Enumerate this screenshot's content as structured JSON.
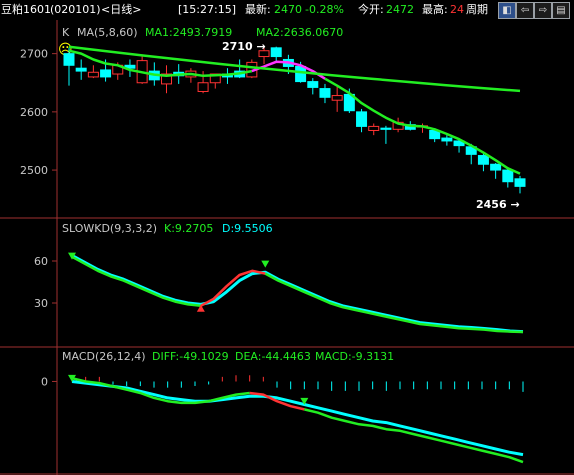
{
  "header": {
    "instrument": "豆粕1601",
    "code": "(020101)",
    "period": "<日线>",
    "time": "[15:27:15]",
    "latest_label": "最新:",
    "latest_value": "2470",
    "change_pct": "-0.28%",
    "open_label": "今开:",
    "open_value": "2472",
    "high_label": "最高:",
    "high_value": "24",
    "cycle_label": "周期",
    "nav_buttons": [
      "◧",
      "⇦",
      "⇨",
      "▤"
    ]
  },
  "colors": {
    "up": "#ff3333",
    "down": "#00ffff",
    "ma_green": "#22ee22",
    "ma_magenta": "#ff33ff",
    "axis": "#a03030",
    "label_gray": "#c8c8c8",
    "white": "#ffffff",
    "yellow": "#ffff00"
  },
  "k_panel": {
    "label": "K",
    "ma_label": "MA(5,8,60)",
    "ma1": "MA1:2493.7919",
    "ma2": "MA2:2636.0670",
    "high_marker": "2710",
    "low_marker": "2456",
    "emoji": "☹",
    "ticks": [
      "2700",
      "2600",
      "2500"
    ]
  },
  "kd_panel": {
    "label": "SLOWKD(9,3,3,2)",
    "k": "K:9.2705",
    "d": "D:9.5506",
    "ticks": [
      "60",
      "30"
    ]
  },
  "macd_panel": {
    "label": "MACD(26,12,4)",
    "diff": "DIFF:-49.1029",
    "dea": "DEA:-44.4463",
    "macd": "MACD:-9.3131",
    "ticks": [
      "0"
    ]
  },
  "chart_data": {
    "type": "candlestick",
    "ohlc_open": [
      2700,
      2675,
      2660,
      2672,
      2665,
      2680,
      2650,
      2670,
      2648,
      2668,
      2660,
      2635,
      2650,
      2665,
      2670,
      2660,
      2695,
      2710,
      2690,
      2678,
      2652,
      2640,
      2620,
      2630,
      2600,
      2568,
      2572,
      2570,
      2578,
      2574,
      2568,
      2555,
      2550,
      2540,
      2525,
      2510,
      2500,
      2485
    ],
    "ohlc_high": [
      2710,
      2690,
      2680,
      2690,
      2685,
      2690,
      2695,
      2685,
      2680,
      2682,
      2675,
      2670,
      2665,
      2675,
      2690,
      2690,
      2710,
      2712,
      2698,
      2686,
      2658,
      2648,
      2645,
      2640,
      2605,
      2580,
      2576,
      2590,
      2584,
      2580,
      2572,
      2560,
      2555,
      2545,
      2530,
      2512,
      2505,
      2490
    ],
    "ohlc_low": [
      2645,
      2655,
      2658,
      2652,
      2655,
      2660,
      2648,
      2645,
      2632,
      2648,
      2650,
      2632,
      2640,
      2648,
      2658,
      2658,
      2682,
      2688,
      2665,
      2650,
      2630,
      2615,
      2600,
      2598,
      2565,
      2560,
      2545,
      2565,
      2568,
      2564,
      2548,
      2542,
      2530,
      2510,
      2498,
      2485,
      2470,
      2460
    ],
    "ohlc_close": [
      2680,
      2670,
      2668,
      2660,
      2680,
      2675,
      2688,
      2655,
      2665,
      2662,
      2670,
      2650,
      2665,
      2660,
      2660,
      2685,
      2705,
      2695,
      2678,
      2652,
      2642,
      2625,
      2628,
      2602,
      2575,
      2575,
      2570,
      2582,
      2570,
      2576,
      2554,
      2550,
      2542,
      2527,
      2510,
      2500,
      2480,
      2472
    ],
    "ma1": [
      2705,
      2700,
      2690,
      2683,
      2680,
      2672,
      2668,
      2664,
      2662,
      2664,
      2665,
      2662,
      2663,
      2664,
      2666,
      2670,
      2678,
      2686,
      2685,
      2680,
      2670,
      2657,
      2645,
      2632,
      2615,
      2602,
      2590,
      2580,
      2576,
      2575,
      2570,
      2562,
      2553,
      2542,
      2530,
      2517,
      2503,
      2494
    ],
    "ma2_start": 2712,
    "ma2_end": 2636,
    "ylim": [
      2440,
      2720
    ],
    "kd_k": [
      63,
      58,
      53,
      49,
      46,
      42,
      38,
      34,
      31,
      29,
      28,
      33,
      42,
      50,
      53,
      51,
      46,
      42,
      38,
      34,
      30,
      27,
      25,
      23,
      21,
      19,
      17,
      15,
      14,
      13,
      12,
      11.5,
      11,
      10,
      9.6,
      9.3
    ],
    "kd_d": [
      64,
      59,
      54,
      50,
      47,
      43,
      39,
      35,
      32,
      30,
      29,
      31,
      38,
      46,
      51,
      52,
      47,
      43,
      39,
      35,
      31,
      28,
      26,
      24,
      22,
      20,
      18,
      16,
      15,
      14,
      13,
      12.5,
      11.8,
      11,
      10,
      9.6
    ],
    "kd_ylim": [
      0,
      75
    ],
    "macd_diff": [
      2,
      0,
      -1,
      -3,
      -5,
      -7,
      -10,
      -12,
      -13,
      -13,
      -12,
      -10,
      -8,
      -7,
      -8,
      -12,
      -15,
      -17,
      -19,
      -22,
      -24,
      -26,
      -27,
      -29,
      -30,
      -32,
      -34,
      -36,
      -38,
      -40,
      -42,
      -44,
      -46,
      -49
    ],
    "macd_dea": [
      0,
      -1,
      -2,
      -3,
      -4,
      -6,
      -8,
      -10,
      -11,
      -12,
      -12,
      -11,
      -10,
      -9,
      -9,
      -10,
      -12,
      -14,
      -16,
      -18,
      -20,
      -22,
      -24,
      -25,
      -27,
      -29,
      -31,
      -33,
      -35,
      -37,
      -39,
      -41,
      -43,
      -44.4
    ],
    "macd_ylim": [
      -55,
      10
    ]
  }
}
